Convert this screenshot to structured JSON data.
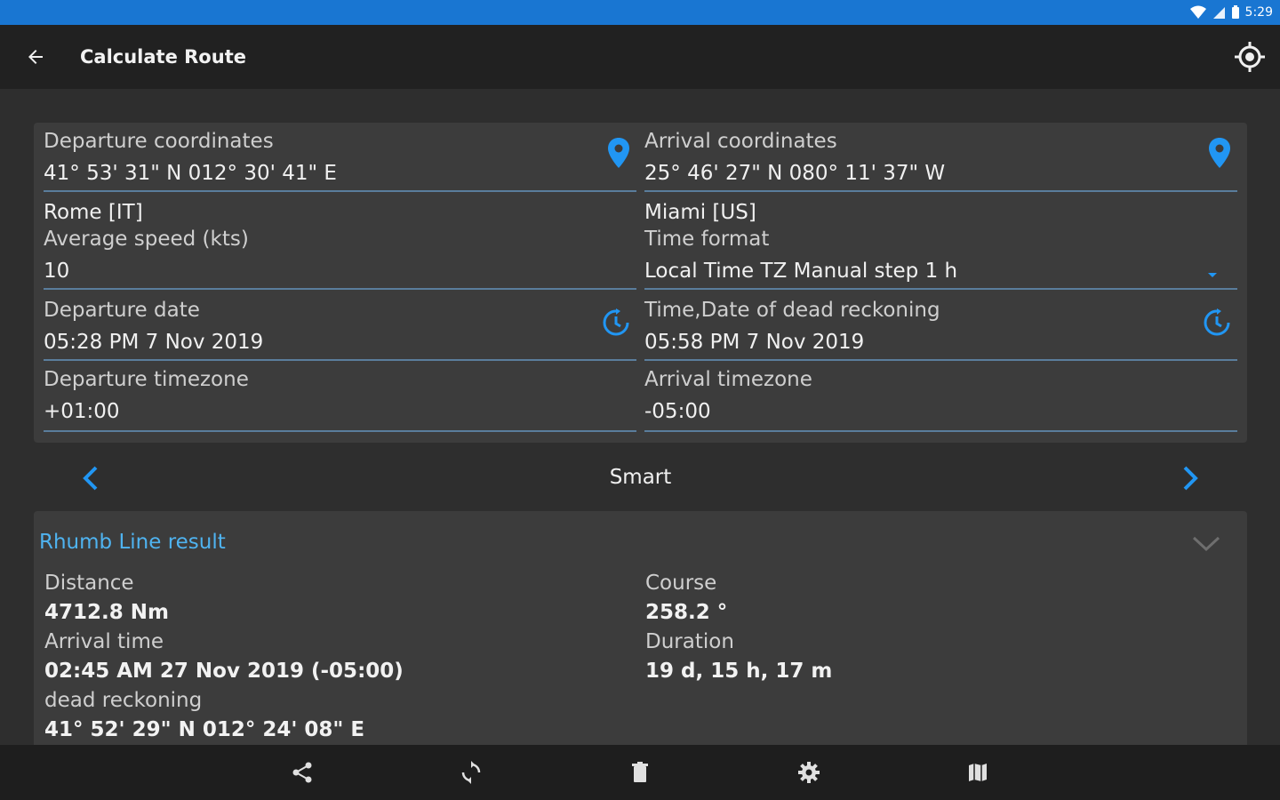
{
  "status": {
    "time": "5:29"
  },
  "appbar": {
    "title": "Calculate Route"
  },
  "departure": {
    "coords_label": "Departure coordinates",
    "coords_value": "41° 53' 31\" N 012° 30' 41\" E",
    "city": "Rome [IT]",
    "speed_label": "Average speed (kts)",
    "speed_value": "10",
    "date_label": "Departure date",
    "date_value": "05:28 PM 7 Nov 2019",
    "tz_label": "Departure timezone",
    "tz_value": "+01:00"
  },
  "arrival": {
    "coords_label": "Arrival coordinates",
    "coords_value": "25° 46' 27\" N 080° 11' 37\" W",
    "city": "Miami [US]",
    "timeformat_label": "Time format",
    "timeformat_value": "Local Time TZ Manual step 1 h",
    "dr_label": "Time,Date of dead reckoning",
    "dr_value": "05:58 PM 7 Nov 2019",
    "tz_label": "Arrival timezone",
    "tz_value": "-05:00"
  },
  "mode": {
    "label": "Smart"
  },
  "result": {
    "title": "Rhumb Line result",
    "distance_label": "Distance",
    "distance_value": "4712.8 Nm",
    "course_label": "Course",
    "course_value": "258.2 °",
    "arrival_time_label": "Arrival time",
    "arrival_time_value": "02:45 AM 27 Nov 2019 (-05:00)",
    "duration_label": "Duration",
    "duration_value": "19 d, 15 h, 17 m",
    "dr_label": "dead reckoning",
    "dr_value": "41° 52' 29\" N 012° 24' 08\" E"
  },
  "colors": {
    "accent": "#2196f3",
    "statusbar": "#1976d2",
    "result_title": "#4fb3f0"
  },
  "icons": {
    "back": "arrow-left-icon",
    "locate": "crosshair-icon",
    "coords": "map-pin-icon",
    "date": "clock-refresh-icon",
    "share": "share-icon",
    "refresh": "refresh-icon",
    "delete": "trash-icon",
    "settings": "gear-icon",
    "map": "map-icon"
  }
}
